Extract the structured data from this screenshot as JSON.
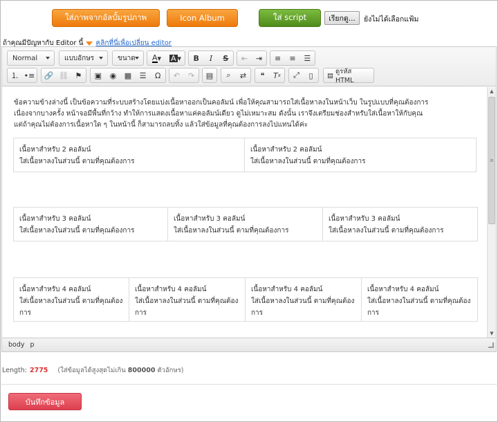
{
  "top_buttons": {
    "album_photo": "ใส่ภาพจากอัลบั้มรูปภาพ",
    "icon_album": "Icon Album",
    "script": "ใส่ script",
    "browse": "เรียกดู...",
    "no_file": "ยังไม่ได้เลือกแฟ้ม"
  },
  "editor_hint": {
    "text": "ถ้าคุณมีปัญหากับ Editor นี้",
    "link": "คลิกที่นี่เพื่อเปลี่ยน editor"
  },
  "toolbar": {
    "format": "Normal",
    "font": "แบบอักษร",
    "size": "ขนาด",
    "bold": "B",
    "italic": "I",
    "underline": "U",
    "strike": "S",
    "source": "ดูรหัส HTML"
  },
  "content": {
    "intro": [
      "ข้อความข้างล่างนี้ เป็นข้อความที่ระบบสร้างโดยแบ่งเนื้อหาออกเป็นคอลัมน์ เพื่อให้คุณสามารถใส่เนื้อหาลงในหน้าเว็บ ในรูปแบบที่คุณต้องการ",
      "เนื่องจากบางครั้ง หน้าจอมีพื้นที่กว้าง ทำให้การแสดงเนื้อหาแค่คอลัมน์เดียว ดูไม่เหมาะสม ดังนั้น เราจึงเตรียมช่องสำหรับใส่เนื้อหาให้กับคุณ",
      "แต่ถ้าคุณไม่ต้องการเนื้อหาใด ๆ ในหน้านี้ ก็สามารถลบทิ้ง แล้วใส่ข้อมูลที่คุณต้องการลงไปแทนได้ค่ะ"
    ],
    "row2": [
      {
        "title": "เนื้อหาสำหรับ 2 คอลัมน์",
        "body": "ใส่เนื้อหาลงในส่วนนี้ ตามที่คุณต้องการ"
      },
      {
        "title": "เนื้อหาสำหรับ 2 คอลัมน์",
        "body": "ใส่เนื้อหาลงในส่วนนี้ ตามที่คุณต้องการ"
      }
    ],
    "row3": [
      {
        "title": "เนื้อหาสำหรับ 3 คอลัมน์",
        "body": "ใส่เนื้อหาลงในส่วนนี้ ตามที่คุณต้องการ"
      },
      {
        "title": "เนื้อหาสำหรับ 3 คอลัมน์",
        "body": "ใส่เนื้อหาลงในส่วนนี้ ตามที่คุณต้องการ"
      },
      {
        "title": "เนื้อหาสำหรับ 3 คอลัมน์",
        "body": "ใส่เนื้อหาลงในส่วนนี้ ตามที่คุณต้องการ"
      }
    ],
    "row4": [
      {
        "title": "เนื้อหาสำหรับ 4 คอลัมน์",
        "body1": "ใส่เนื้อหาลงในส่วนนี้ ตามที่คุณต้อง",
        "body2": "การ"
      },
      {
        "title": "เนื้อหาสำหรับ 4 คอลัมน์",
        "body1": "ใส่เนื้อหาลงในส่วนนี้ ตามที่คุณต้อง",
        "body2": "การ"
      },
      {
        "title": "เนื้อหาสำหรับ 4 คอลัมน์",
        "body1": "ใส่เนื้อหาลงในส่วนนี้ ตามที่คุณต้อง",
        "body2": "การ"
      },
      {
        "title": "เนื้อหาสำหรับ 4 คอลัมน์",
        "body1": "ใส่เนื้อหาลงในส่วนนี้ ตามที่คุณต้อง",
        "body2": "การ"
      }
    ]
  },
  "pathbar": {
    "body": "body",
    "p": "p"
  },
  "length": {
    "label": "Length:",
    "value": "2775",
    "note_prefix": "(ใส่ข้อมูลได้สูงสุดไม่เกิน",
    "max": "800000",
    "note_suffix": "ตัวอักษร)"
  },
  "save_button": "บันทึกข้อมูล",
  "colors": {
    "accent_orange": "#f08a1a",
    "accent_green": "#5a9a25",
    "save_red": "#e84a5a",
    "length_red": "#d33333"
  }
}
